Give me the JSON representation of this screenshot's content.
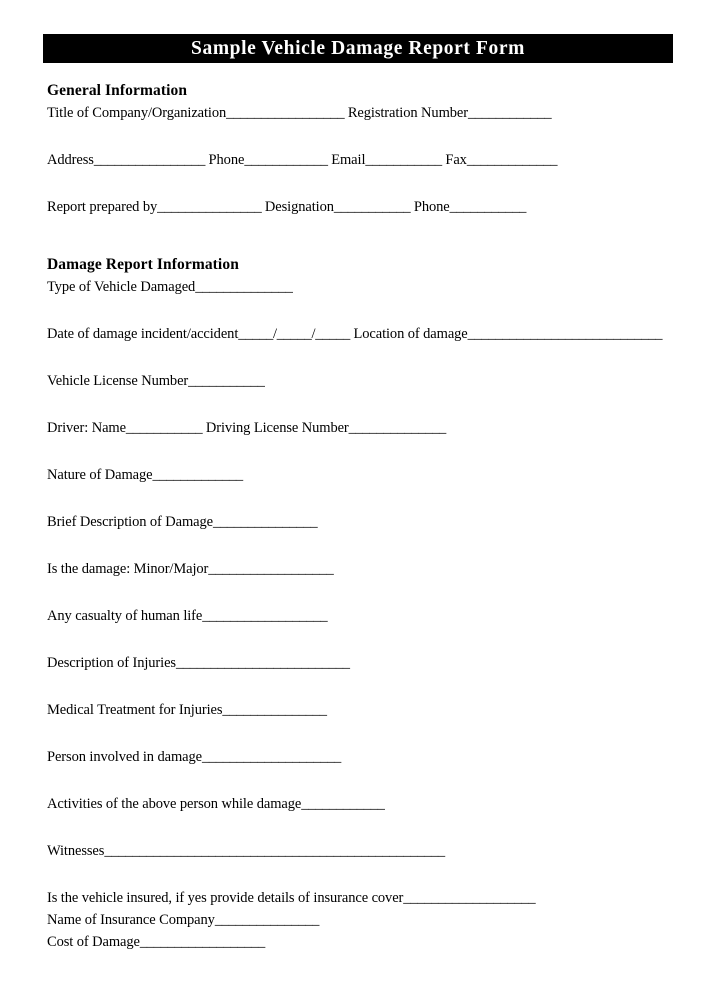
{
  "document": {
    "title": "Sample Vehicle Damage Report Form",
    "sections": [
      {
        "heading": "General Information",
        "fields": [
          {
            "label": "Title of Company/Organization",
            "rule": "_________________",
            "label2": " Registration Number",
            "rule2": "____________"
          },
          {
            "label": "Address",
            "rule": "________________",
            "label2": " Phone",
            "rule2": "____________",
            "label3": " Email",
            "rule3": "___________",
            "label4": " Fax",
            "rule4": "_____________"
          },
          {
            "label": "Report prepared by",
            "rule": "_______________",
            "label2": " Designation",
            "rule2": "___________",
            "label3": " Phone",
            "rule3": "___________"
          }
        ]
      },
      {
        "heading": "Damage Report Information",
        "fields": [
          {
            "label": "Type of Vehicle Damaged",
            "rule": "______________"
          },
          {
            "label": "Date of damage incident/accident",
            "rule": "_____/_____/_____",
            "label2": " Location of damage",
            "rule2": "____________________________"
          },
          {
            "label": "Vehicle License Number",
            "rule": "___________"
          },
          {
            "label": "Driver: Name",
            "rule": "___________",
            "label2": " Driving License Number",
            "rule2": "______________"
          },
          {
            "label": "Nature of Damage",
            "rule": "_____________"
          },
          {
            "label": "Brief Description of Damage",
            "rule": "_______________"
          },
          {
            "label": "Is the damage: Minor/Major",
            "rule": "__________________"
          },
          {
            "label": "Any casualty of human life",
            "rule": "__________________"
          },
          {
            "label": "Description of Injuries",
            "rule": "_________________________"
          },
          {
            "label": "Medical Treatment for Injuries",
            "rule": "_______________"
          },
          {
            "label": "Person involved in damage",
            "rule": "____________________"
          },
          {
            "label": "Activities of the above person while damage",
            "rule": "____________"
          },
          {
            "label": "Witnesses",
            "rule": "_________________________________________________"
          },
          {
            "label": "Is the vehicle insured, if yes provide details of insurance cover",
            "rule": "___________________"
          },
          {
            "label": "Name of Insurance Company",
            "rule": "_______________"
          },
          {
            "label": "Cost of Damage",
            "rule": "__________________"
          }
        ]
      }
    ]
  }
}
